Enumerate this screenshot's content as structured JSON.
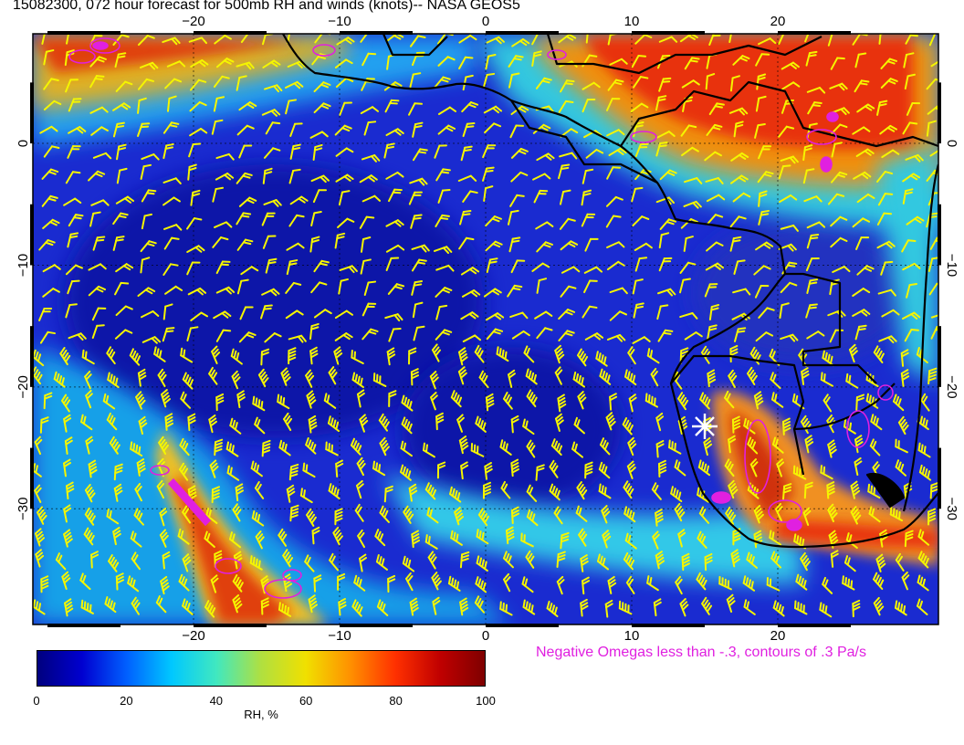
{
  "title": "15082300, 072 hour forecast for 500mb RH and winds (knots)-- NASA GEOS5",
  "lon_axis": {
    "labels": [
      "−20",
      "−10",
      "0",
      "10",
      "20"
    ],
    "values": [
      -20,
      -10,
      0,
      10,
      20
    ]
  },
  "lat_axis": {
    "labels": [
      "0",
      "−10",
      "−20",
      "−30"
    ],
    "values": [
      0,
      -10,
      -20,
      -30
    ]
  },
  "map_extent": {
    "lon": [
      -31,
      31
    ],
    "lat": [
      -39.5,
      9
    ]
  },
  "omega_note": "Negative Omegas less than -.3, contours of .3 Pa/s",
  "colorbar": {
    "tick_labels": [
      "0",
      "20",
      "40",
      "60",
      "80",
      "100"
    ],
    "tick_values": [
      0,
      20,
      40,
      60,
      80,
      100
    ],
    "label": "RH, %",
    "range": [
      0,
      100
    ],
    "colors": [
      "#00007f",
      "#0000d0",
      "#0060ff",
      "#00c8ff",
      "#40e8c0",
      "#b0e040",
      "#f0e000",
      "#ff9000",
      "#ff3000",
      "#c00000",
      "#7f0000"
    ]
  },
  "colors": {
    "wind_barb": "#f5f500",
    "omega_contour": "#e020e0",
    "coastline": "#000000",
    "marker": "#ffffff"
  },
  "marker": {
    "icon": "asterisk-marker",
    "lon": 15,
    "lat": -24
  }
}
